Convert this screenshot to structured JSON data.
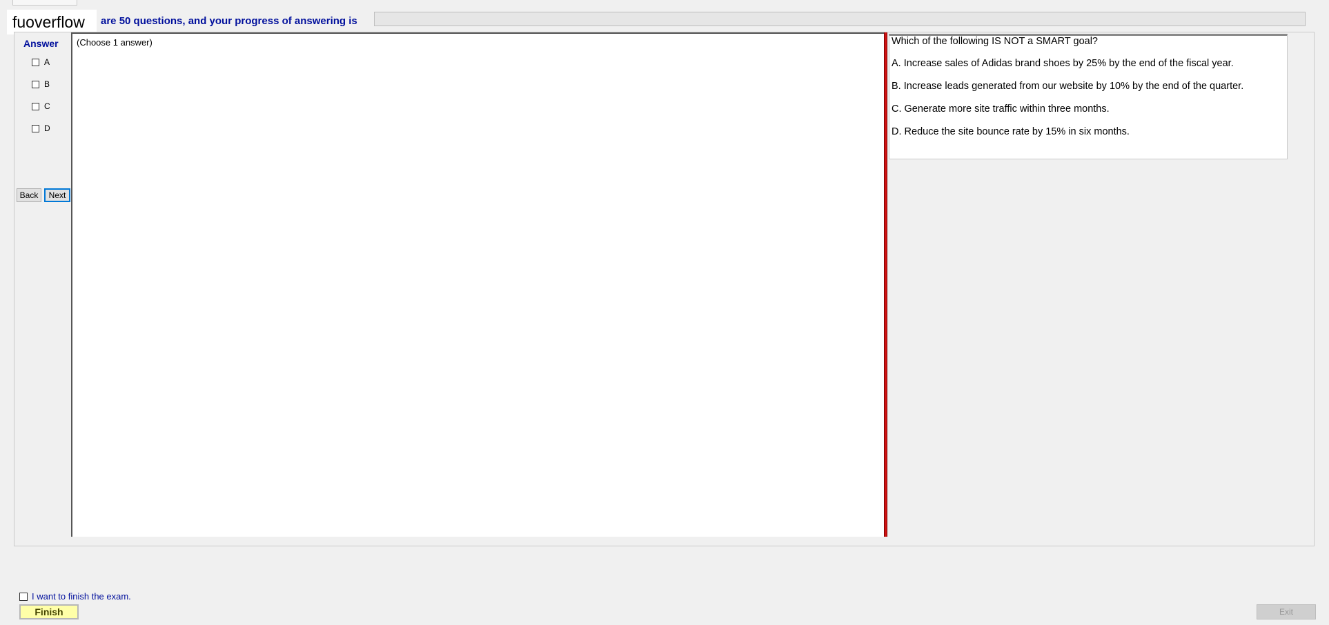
{
  "header": {
    "watermark": "fuoverflow",
    "progress_text": "are 50 questions, and your progress of answering is",
    "progress_value": 0
  },
  "answer_panel": {
    "title": "Answer",
    "options": [
      "A",
      "B",
      "C",
      "D"
    ],
    "choose_hint": "(Choose 1 answer)"
  },
  "nav": {
    "back_label": "Back",
    "next_label": "Next"
  },
  "question": {
    "text": "Which of the following IS NOT a SMART goal?",
    "choices": [
      "A.  Increase sales of Adidas brand shoes by 25% by the end of the fiscal year.",
      "B.  Increase leads generated from our website by 10% by the end of the quarter.",
      "C.  Generate more site traffic within three months.",
      "D.  Reduce the site bounce rate by 15% in six months."
    ]
  },
  "footer": {
    "finish_check_label": "I want to finish the exam.",
    "finish_label": "Finish",
    "exit_label": "Exit"
  },
  "colors": {
    "accent_blue": "#000f9c",
    "splitter_red": "#d11313",
    "finish_yellow": "#ffffa8"
  }
}
